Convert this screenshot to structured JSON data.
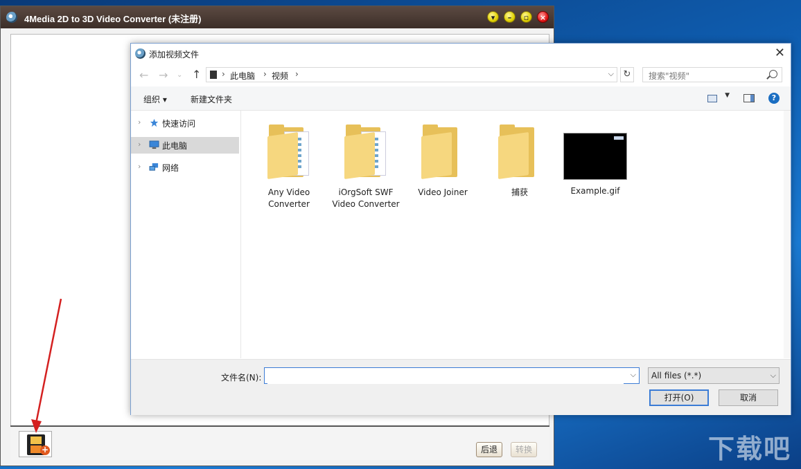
{
  "app": {
    "title": "4Media 2D to 3D Video Converter (未注册)",
    "window_buttons": [
      "dropdown",
      "minimize",
      "maximize",
      "close"
    ],
    "back_label": "后退",
    "convert_label": "转换"
  },
  "dialog": {
    "title": "添加视频文件",
    "breadcrumb": [
      "此电脑",
      "视频"
    ],
    "search_placeholder": "搜索\"视频\"",
    "toolbar": {
      "organize": "组织",
      "new_folder": "新建文件夹"
    },
    "nav": [
      {
        "label": "快速访问",
        "icon": "quick-access-star-icon",
        "selected": false
      },
      {
        "label": "此电脑",
        "icon": "this-pc-icon",
        "selected": true
      },
      {
        "label": "网络",
        "icon": "network-icon",
        "selected": false
      }
    ],
    "files": [
      {
        "name": "Any Video Converter",
        "type": "folder-with-docs"
      },
      {
        "name": "iOrgSoft SWF Video Converter",
        "type": "folder-with-docs"
      },
      {
        "name": "Video Joiner",
        "type": "folder"
      },
      {
        "name": "捕获",
        "type": "folder"
      },
      {
        "name": "Example.gif",
        "type": "image-thumbnail"
      }
    ],
    "filename_label": "文件名(N):",
    "filename_value": "",
    "filter_value": "All files (*.*)",
    "open_label": "打开(O)",
    "cancel_label": "取消"
  },
  "watermark": "下载吧",
  "colors": {
    "accent": "#3a7bd5",
    "title_bar": "#4a3a33",
    "arrow": "#d42020",
    "selected_nav": "#d9d9d9"
  }
}
